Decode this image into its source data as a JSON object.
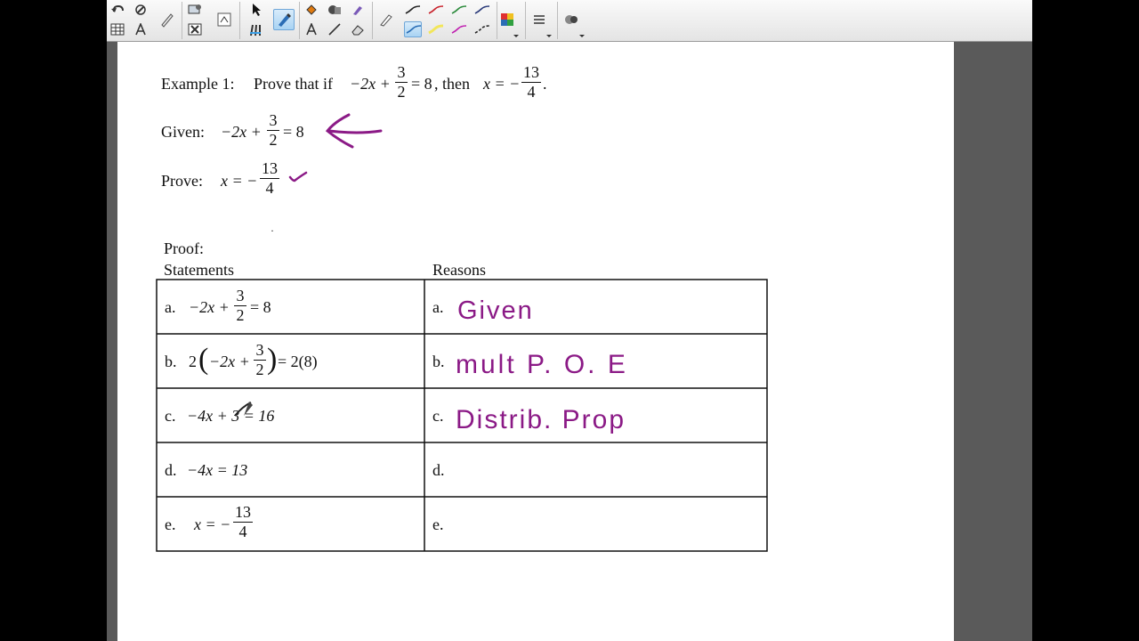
{
  "toolbar": {
    "tools": [
      "undo-redo",
      "table",
      "eraser-settings",
      "text-tool",
      "pen-tool",
      "pen-color",
      "shapes",
      "eraser",
      "lines",
      "line-styles",
      "color-palette",
      "properties",
      "more"
    ]
  },
  "worksheet": {
    "example_label": "Example 1:",
    "example_text": "Prove that if",
    "example_then": ", then",
    "given_label": "Given:",
    "prove_label": "Prove:",
    "proof_label": "Proof:",
    "statements_header": "Statements",
    "reasons_header": "Reasons",
    "expr_neg2x_plus": "−2x +",
    "eq_8": "= 8",
    "frac_3": "3",
    "frac_2": "2",
    "frac_13": "13",
    "frac_4": "4",
    "x_equals_neg": "x = −",
    "rows": [
      {
        "label": "a.",
        "statement": "",
        "reason_label": "a.",
        "ink": "Given"
      },
      {
        "label": "b.",
        "statement_pre": "2",
        "statement_inner": "−2x +",
        "statement_post": "= 2(8)",
        "reason_label": "b.",
        "ink": "mult P. O. E"
      },
      {
        "label": "c.",
        "statement": "−4x + 3 = 16",
        "reason_label": "c.",
        "ink": "Distrib. Prop"
      },
      {
        "label": "d.",
        "statement": "−4x = 13",
        "reason_label": "d.",
        "ink": ""
      },
      {
        "label": "e.",
        "statement": "x = −",
        "reason_label": "e.",
        "ink": ""
      }
    ]
  },
  "colors": {
    "ink": "#8b1a86",
    "accent": "#3aa0e8"
  }
}
